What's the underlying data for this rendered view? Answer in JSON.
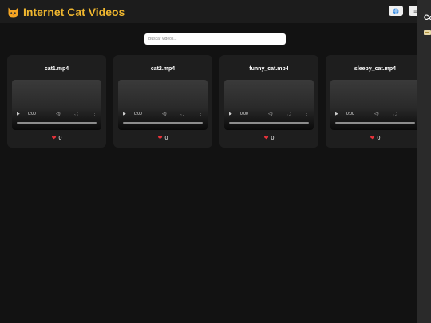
{
  "header": {
    "title": "Internet Cat Videos",
    "logo_icon": "cat-face-icon",
    "buttons": [
      {
        "icon": "globe-icon"
      },
      {
        "icon": "menu-icon"
      }
    ],
    "colors": {
      "title": "#f0b72f",
      "bar": "#1c1c1c"
    }
  },
  "search": {
    "placeholder": "Buscar videos...",
    "value": ""
  },
  "videos": [
    {
      "title": "cat1.mp4",
      "time": "0:00",
      "likes": "0",
      "progress": 0
    },
    {
      "title": "cat2.mp4",
      "time": "0:00",
      "likes": "0",
      "progress": 0
    },
    {
      "title": "funny_cat.mp4",
      "time": "0:00",
      "likes": "0",
      "progress": 0
    },
    {
      "title": "sleepy_cat.mp4",
      "time": "0:00",
      "likes": "0",
      "progress": 0
    }
  ],
  "side_panel": {
    "title": "Co",
    "icon": "folder-icon"
  },
  "icons": {
    "play": "▶",
    "volume": "🔊",
    "fullscreen": "⛶",
    "more": "⋮",
    "heart": "❤️"
  }
}
